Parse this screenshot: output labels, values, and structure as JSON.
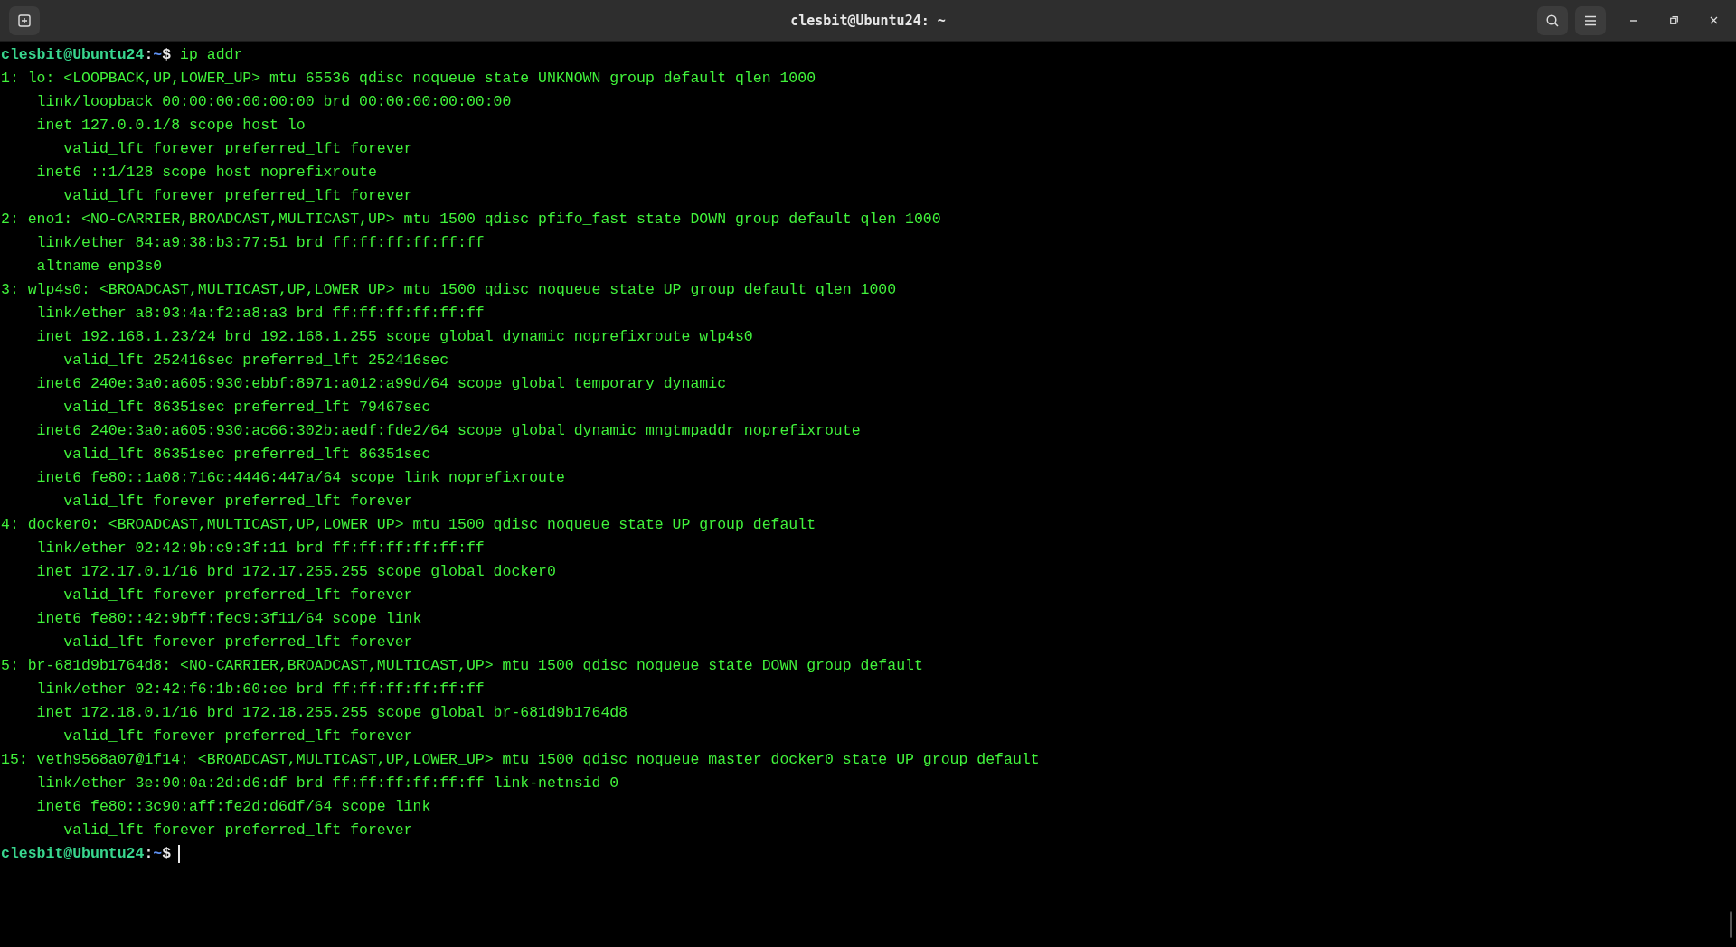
{
  "window": {
    "title": "clesbit@Ubuntu24: ~"
  },
  "terminal": {
    "lines": [
      {
        "kind": "prompt",
        "user": "clesbit@Ubuntu24",
        "separator": ":",
        "path": "~",
        "symbol": "$",
        "command": "ip addr",
        "cursor": false
      },
      {
        "kind": "output",
        "text": "1: lo: <LOOPBACK,UP,LOWER_UP> mtu 65536 qdisc noqueue state UNKNOWN group default qlen 1000"
      },
      {
        "kind": "output",
        "text": "    link/loopback 00:00:00:00:00:00 brd 00:00:00:00:00:00"
      },
      {
        "kind": "output",
        "text": "    inet 127.0.0.1/8 scope host lo"
      },
      {
        "kind": "output",
        "text": "       valid_lft forever preferred_lft forever"
      },
      {
        "kind": "output",
        "text": "    inet6 ::1/128 scope host noprefixroute"
      },
      {
        "kind": "output",
        "text": "       valid_lft forever preferred_lft forever"
      },
      {
        "kind": "output",
        "text": "2: eno1: <NO-CARRIER,BROADCAST,MULTICAST,UP> mtu 1500 qdisc pfifo_fast state DOWN group default qlen 1000"
      },
      {
        "kind": "output",
        "text": "    link/ether 84:a9:38:b3:77:51 brd ff:ff:ff:ff:ff:ff"
      },
      {
        "kind": "output",
        "text": "    altname enp3s0"
      },
      {
        "kind": "output",
        "text": "3: wlp4s0: <BROADCAST,MULTICAST,UP,LOWER_UP> mtu 1500 qdisc noqueue state UP group default qlen 1000"
      },
      {
        "kind": "output",
        "text": "    link/ether a8:93:4a:f2:a8:a3 brd ff:ff:ff:ff:ff:ff"
      },
      {
        "kind": "output",
        "text": "    inet 192.168.1.23/24 brd 192.168.1.255 scope global dynamic noprefixroute wlp4s0"
      },
      {
        "kind": "output",
        "text": "       valid_lft 252416sec preferred_lft 252416sec"
      },
      {
        "kind": "output",
        "text": "    inet6 240e:3a0:a605:930:ebbf:8971:a012:a99d/64 scope global temporary dynamic"
      },
      {
        "kind": "output",
        "text": "       valid_lft 86351sec preferred_lft 79467sec"
      },
      {
        "kind": "output",
        "text": "    inet6 240e:3a0:a605:930:ac66:302b:aedf:fde2/64 scope global dynamic mngtmpaddr noprefixroute"
      },
      {
        "kind": "output",
        "text": "       valid_lft 86351sec preferred_lft 86351sec"
      },
      {
        "kind": "output",
        "text": "    inet6 fe80::1a08:716c:4446:447a/64 scope link noprefixroute"
      },
      {
        "kind": "output",
        "text": "       valid_lft forever preferred_lft forever"
      },
      {
        "kind": "output",
        "text": "4: docker0: <BROADCAST,MULTICAST,UP,LOWER_UP> mtu 1500 qdisc noqueue state UP group default"
      },
      {
        "kind": "output",
        "text": "    link/ether 02:42:9b:c9:3f:11 brd ff:ff:ff:ff:ff:ff"
      },
      {
        "kind": "output",
        "text": "    inet 172.17.0.1/16 brd 172.17.255.255 scope global docker0"
      },
      {
        "kind": "output",
        "text": "       valid_lft forever preferred_lft forever"
      },
      {
        "kind": "output",
        "text": "    inet6 fe80::42:9bff:fec9:3f11/64 scope link"
      },
      {
        "kind": "output",
        "text": "       valid_lft forever preferred_lft forever"
      },
      {
        "kind": "output",
        "text": "5: br-681d9b1764d8: <NO-CARRIER,BROADCAST,MULTICAST,UP> mtu 1500 qdisc noqueue state DOWN group default"
      },
      {
        "kind": "output",
        "text": "    link/ether 02:42:f6:1b:60:ee brd ff:ff:ff:ff:ff:ff"
      },
      {
        "kind": "output",
        "text": "    inet 172.18.0.1/16 brd 172.18.255.255 scope global br-681d9b1764d8"
      },
      {
        "kind": "output",
        "text": "       valid_lft forever preferred_lft forever"
      },
      {
        "kind": "output",
        "text": "15: veth9568a07@if14: <BROADCAST,MULTICAST,UP,LOWER_UP> mtu 1500 qdisc noqueue master docker0 state UP group default"
      },
      {
        "kind": "output",
        "text": "    link/ether 3e:90:0a:2d:d6:df brd ff:ff:ff:ff:ff:ff link-netnsid 0"
      },
      {
        "kind": "output",
        "text": "    inet6 fe80::3c90:aff:fe2d:d6df/64 scope link"
      },
      {
        "kind": "output",
        "text": "       valid_lft forever preferred_lft forever"
      },
      {
        "kind": "prompt",
        "user": "clesbit@Ubuntu24",
        "separator": ":",
        "path": "~",
        "symbol": "$",
        "cursor": true
      }
    ]
  }
}
